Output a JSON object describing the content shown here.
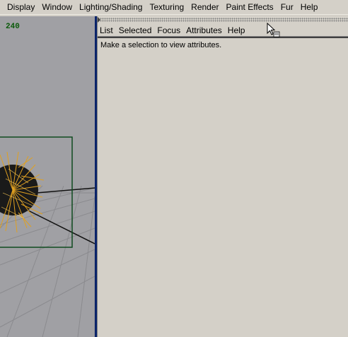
{
  "main_menu": {
    "items": [
      {
        "label": "Display"
      },
      {
        "label": "Window"
      },
      {
        "label": "Lighting/Shading"
      },
      {
        "label": "Texturing"
      },
      {
        "label": "Render"
      },
      {
        "label": "Paint Effects"
      },
      {
        "label": "Fur"
      },
      {
        "label": "Help"
      }
    ]
  },
  "viewport": {
    "frame_counter": "240"
  },
  "attribute_editor": {
    "menu": [
      {
        "label": "List"
      },
      {
        "label": "Selected"
      },
      {
        "label": "Focus"
      },
      {
        "label": "Attributes"
      },
      {
        "label": "Help"
      }
    ],
    "message": "Make a selection to view attributes."
  },
  "colors": {
    "viewport_bg": "#a0a0a4",
    "panel_bg": "#d4d0c8",
    "active_border": "#0a246a",
    "selection_box": "#0f4a1e",
    "fur": "#e0a020"
  }
}
